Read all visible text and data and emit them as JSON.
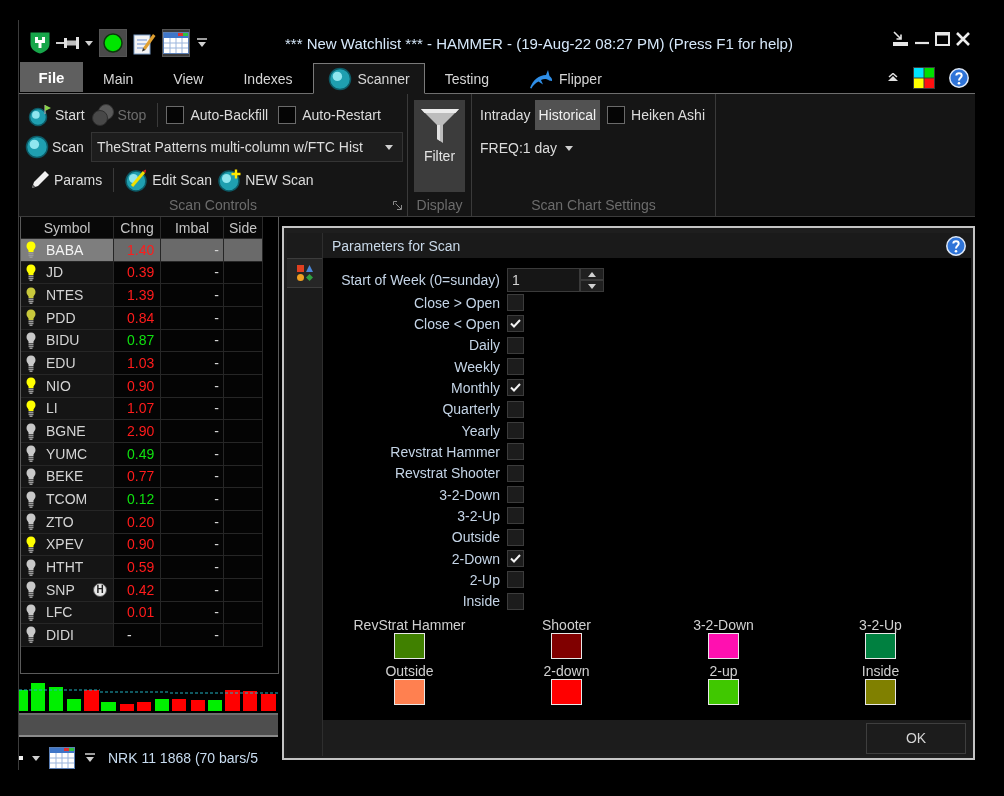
{
  "title_bar": {
    "title": "*** New Watchlist *** - HAMMER - (19-Aug-22 08:27 PM) (Press F1 for help)"
  },
  "tabs": [
    {
      "label": "File",
      "kind": "file",
      "selected": false
    },
    {
      "label": "Main",
      "kind": "plain",
      "selected": false
    },
    {
      "label": "View",
      "kind": "plain",
      "selected": false
    },
    {
      "label": "Indexes",
      "kind": "plain",
      "selected": false
    },
    {
      "label": "Scanner",
      "kind": "scanner",
      "selected": true
    },
    {
      "label": "Testing",
      "kind": "plain",
      "selected": false
    },
    {
      "label": "Flipper",
      "kind": "flipper",
      "selected": false
    }
  ],
  "ribbon": {
    "scan_controls": {
      "start": {
        "label": "Start",
        "disabled": false
      },
      "stop": {
        "label": "Stop",
        "disabled": true
      },
      "auto_backfill": {
        "label": "Auto-Backfill",
        "checked": false
      },
      "auto_restart": {
        "label": "Auto-Restart",
        "checked": false
      },
      "scan": {
        "label": "Scan"
      },
      "scan_select": {
        "value": "TheStrat Patterns multi-column w/FTC Hist"
      },
      "params": {
        "label": "Params"
      },
      "edit_scan": {
        "label": "Edit Scan"
      },
      "new_scan": {
        "label": "NEW Scan"
      },
      "group_label": "Scan Controls"
    },
    "display": {
      "filter": {
        "label": "Filter"
      },
      "group_label": "Display"
    },
    "scan_chart_settings": {
      "modes": [
        {
          "label": "Intraday",
          "selected": false
        },
        {
          "label": "Historical",
          "selected": true
        }
      ],
      "heiken_ashi": {
        "label": "Heiken Ashi",
        "checked": false
      },
      "frequency": {
        "value": "FREQ:1 day"
      },
      "group_label": "Scan Chart Settings"
    }
  },
  "watchlist": {
    "columns": [
      "Symbol",
      "Chng",
      "Imbal",
      "Side"
    ],
    "rows": [
      {
        "symbol": "BABA",
        "bulb": {
          "color": "#ffff00"
        },
        "change": {
          "text": "1.40",
          "color": "#ff1c1c"
        },
        "imbal": "-",
        "selected": true
      },
      {
        "symbol": "JD",
        "bulb": {
          "color": "#ffff00"
        },
        "change": {
          "text": "0.39",
          "color": "#ff1c1c"
        },
        "imbal": "-",
        "selected": false
      },
      {
        "symbol": "NTES",
        "bulb": {
          "color": "#c8c83c"
        },
        "change": {
          "text": "1.39",
          "color": "#ff1c1c"
        },
        "imbal": "-",
        "selected": false
      },
      {
        "symbol": "PDD",
        "bulb": {
          "color": "#c8c83c"
        },
        "change": {
          "text": "0.84",
          "color": "#ff1c1c"
        },
        "imbal": "-",
        "selected": false
      },
      {
        "symbol": "BIDU",
        "bulb": {
          "color": "#c8c8c8"
        },
        "change": {
          "text": "0.87",
          "color": "#10e010"
        },
        "imbal": "-",
        "selected": false
      },
      {
        "symbol": "EDU",
        "bulb": {
          "color": "#c8c8c8"
        },
        "change": {
          "text": "1.03",
          "color": "#ff1c1c"
        },
        "imbal": "-",
        "selected": false
      },
      {
        "symbol": "NIO",
        "bulb": {
          "color": "#ffff00"
        },
        "change": {
          "text": "0.90",
          "color": "#ff1c1c"
        },
        "imbal": "-",
        "selected": false
      },
      {
        "symbol": "LI",
        "bulb": {
          "color": "#ffff00"
        },
        "change": {
          "text": "1.07",
          "color": "#ff1c1c"
        },
        "imbal": "-",
        "selected": false
      },
      {
        "symbol": "BGNE",
        "bulb": {
          "color": "#c8c8c8"
        },
        "change": {
          "text": "2.90",
          "color": "#ff1c1c"
        },
        "imbal": "-",
        "selected": false
      },
      {
        "symbol": "YUMC",
        "bulb": {
          "color": "#c8c8c8"
        },
        "change": {
          "text": "0.49",
          "color": "#10e010"
        },
        "imbal": "-",
        "selected": false
      },
      {
        "symbol": "BEKE",
        "bulb": {
          "color": "#c8c8c8"
        },
        "change": {
          "text": "0.77",
          "color": "#ff1c1c"
        },
        "imbal": "-",
        "selected": false
      },
      {
        "symbol": "TCOM",
        "bulb": {
          "color": "#c8c8c8"
        },
        "change": {
          "text": "0.12",
          "color": "#10e010"
        },
        "imbal": "-",
        "selected": false
      },
      {
        "symbol": "ZTO",
        "bulb": {
          "color": "#c8c8c8"
        },
        "change": {
          "text": "0.20",
          "color": "#ff1c1c"
        },
        "imbal": "-",
        "selected": false
      },
      {
        "symbol": "XPEV",
        "bulb": {
          "color": "#ffff00"
        },
        "change": {
          "text": "0.90",
          "color": "#ff1c1c"
        },
        "imbal": "-",
        "selected": false
      },
      {
        "symbol": "HTHT",
        "bulb": {
          "color": "#c8c8c8"
        },
        "change": {
          "text": "0.59",
          "color": "#ff1c1c"
        },
        "imbal": "-",
        "selected": false
      },
      {
        "symbol": "SNP",
        "bulb": {
          "color": "#c8c8c8"
        },
        "badge": "H",
        "change": {
          "text": "0.42",
          "color": "#ff1c1c"
        },
        "imbal": "-",
        "selected": false
      },
      {
        "symbol": "LFC",
        "bulb": {
          "color": "#c8c8c8"
        },
        "change": {
          "text": "0.01",
          "color": "#ff1c1c"
        },
        "imbal": "-",
        "selected": false
      },
      {
        "symbol": "DIDI",
        "bulb": {
          "color": "#c8c8c8"
        },
        "change": {
          "text": "-",
          "color": "#e0e0e0"
        },
        "imbal": "-",
        "selected": false
      }
    ]
  },
  "status_bar": {
    "text": "NRK 11 1868 (70 bars/5"
  },
  "dialog": {
    "title": "Parameters for Scan",
    "start_of_week": {
      "label": "Start of Week (0=sunday)",
      "value": "1"
    },
    "options": [
      {
        "label": "Close > Open",
        "checked": false
      },
      {
        "label": "Close < Open",
        "checked": true
      },
      {
        "label": "Daily",
        "checked": false
      },
      {
        "label": "Weekly",
        "checked": false
      },
      {
        "label": "Monthly",
        "checked": true
      },
      {
        "label": "Quarterly",
        "checked": false
      },
      {
        "label": "Yearly",
        "checked": false
      },
      {
        "label": "Revstrat Hammer",
        "checked": false
      },
      {
        "label": "Revstrat Shooter",
        "checked": false
      },
      {
        "label": "3-2-Down",
        "checked": false
      },
      {
        "label": "3-2-Up",
        "checked": false
      },
      {
        "label": "Outside",
        "checked": false
      },
      {
        "label": "2-Down",
        "checked": true
      },
      {
        "label": "2-Up",
        "checked": false
      },
      {
        "label": "Inside",
        "checked": false
      }
    ],
    "swatches": [
      {
        "label": "RevStrat Hammer",
        "color": "#408000"
      },
      {
        "label": "Shooter",
        "color": "#800000"
      },
      {
        "label": "3-2-Down",
        "color": "#ff10b0"
      },
      {
        "label": "3-2-Up",
        "color": "#008040"
      },
      {
        "label": "Outside",
        "color": "#ff8050"
      },
      {
        "label": "2-down",
        "color": "#ff0000"
      },
      {
        "label": "2-up",
        "color": "#40c800"
      },
      {
        "label": "Inside",
        "color": "#808000"
      }
    ],
    "ok_button": "OK"
  }
}
